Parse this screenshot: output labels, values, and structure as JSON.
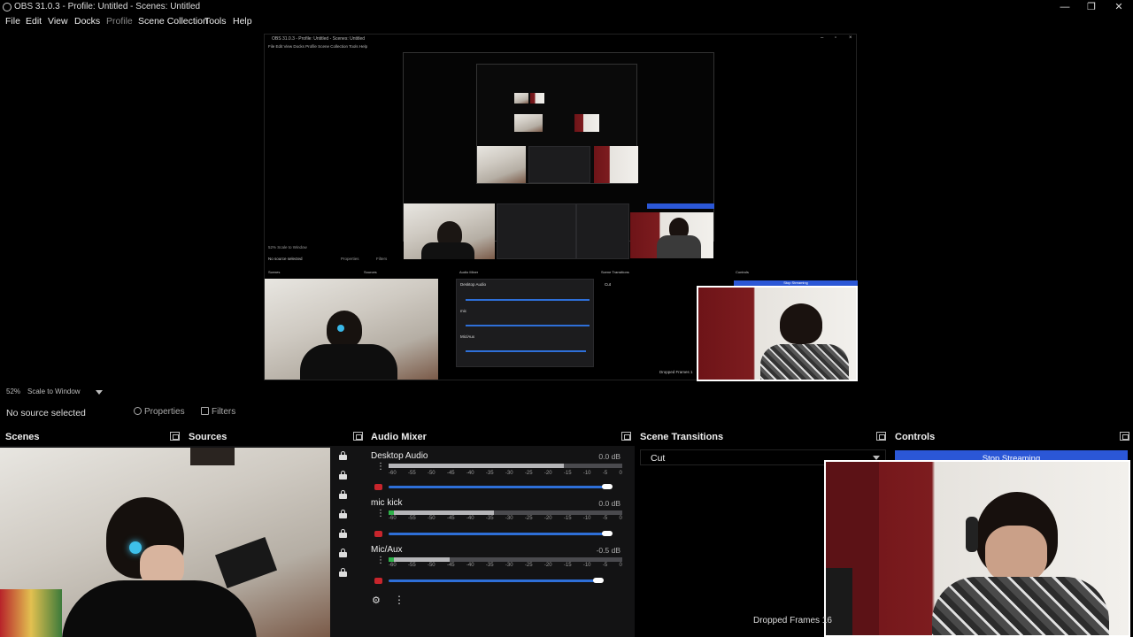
{
  "window": {
    "title": "OBS 31.0.3 - Profile: Untitled - Scenes: Untitled",
    "minimize": "—",
    "maximize": "❐",
    "close": "✕"
  },
  "menubar": {
    "items": [
      "File",
      "Edit",
      "View",
      "Docks",
      "Profile",
      "Scene Collection",
      "Tools",
      "Help"
    ]
  },
  "nested": {
    "title": "OBS 31.0.3 - Profile: Untitled - Scenes: Untitled",
    "menu": "File  Edit  View  Docks  Profile  Scene Collection  Tools  Help",
    "zoom": "52%   Scale to Window",
    "no_source": "No source selected",
    "properties": "Properties",
    "filters": "Filters",
    "scenes": "Scenes",
    "sources": "Sources",
    "audio_mixer": "Audio Mixer",
    "scene_transitions": "Scene Transitions",
    "controls": "Controls",
    "desktop_audio": "Desktop Audio",
    "mic": "mic",
    "mic_aux": "Mic/Aux",
    "cut": "Cut",
    "stop": "Stop Streaming",
    "dropped": "Dropped Frames 1"
  },
  "preview_bar": {
    "zoom_percent": "52%",
    "scale_mode": "Scale to Window"
  },
  "source_bar": {
    "no_source": "No source selected",
    "properties": "Properties",
    "filters": "Filters"
  },
  "docks": {
    "scenes": "Scenes",
    "sources": "Sources",
    "audio_mixer": "Audio Mixer",
    "scene_transitions": "Scene Transitions",
    "controls": "Controls"
  },
  "mixer": {
    "channels": [
      {
        "name": "Desktop Audio",
        "db": "0.0 dB",
        "level": 0.75,
        "volume": 0.98
      },
      {
        "name": "mic kick",
        "db": "0.0 dB",
        "level": 0.45,
        "volume": 0.98
      },
      {
        "name": "Mic/Aux",
        "db": "-0.5 dB",
        "level": 0.26,
        "volume": 0.94
      }
    ],
    "ticks": [
      "-60",
      "-55",
      "-50",
      "-45",
      "-40",
      "-35",
      "-30",
      "-25",
      "-20",
      "-15",
      "-10",
      "-5",
      "0"
    ]
  },
  "transitions": {
    "selected": "Cut"
  },
  "controls": {
    "stop_streaming": "Stop Streaming"
  },
  "status": {
    "dropped_frames": "Dropped Frames 16"
  },
  "colors": {
    "stream_button": "#2b57d6",
    "volume_slider": "#2e6fd8",
    "mute_indicator": "#c7252c"
  }
}
